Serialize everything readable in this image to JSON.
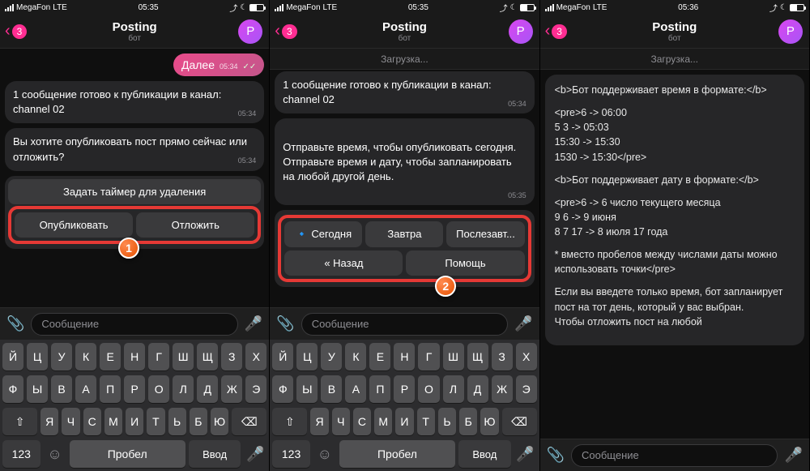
{
  "status": {
    "carrier": "MegaFon",
    "net": "LTE",
    "time1": "05:35",
    "time2": "05:35",
    "time3": "05:36",
    "moon": "☾"
  },
  "nav": {
    "back_badge": "3",
    "title": "Posting",
    "subtitle": "бот",
    "avatar_letter": "P"
  },
  "loading": "Загрузка...",
  "p1": {
    "out_msg": "Далее",
    "out_time": "05:34",
    "b1": "1 сообщение готово к публикации в канал: channel 02",
    "b1_time": "05:34",
    "b2": "Вы хотите опубликовать пост прямо сейчас или отложить?",
    "b2_time": "05:34",
    "kb_timer": "Задать таймер для удаления",
    "kb_publish": "Опубликовать",
    "kb_delay": "Отложить"
  },
  "p2": {
    "b1_l1": "1 сообщение готово к публикации в канал: channel 02",
    "b1_time": "05:34",
    "b2": "Отправьте время, чтобы опубликовать сегодня.\nОтправьте время и дату, чтобы запланировать на любой другой день.",
    "b2_time": "05:35",
    "kb_today": "🔹 Сегодня",
    "kb_tomorrow": "Завтра",
    "kb_after": "Послезавт...",
    "kb_back": "« Назад",
    "kb_help": "Помощь"
  },
  "p3": {
    "line1": "<b>Бот поддерживает время в формате:</b>",
    "line2": "<pre>6      -> 06:00",
    "line3": "5 3   -> 05:03",
    "line4": "15:30 -> 15:30",
    "line5": "1530  -> 15:30</pre>",
    "dfmt": "<b>Бот поддерживает дату в формате:</b>",
    "d1": "<pre>6     -> 6 число текущего месяца",
    "d2": "9 6   -> 9 июня",
    "d3": "8 7 17 -> 8 июля 17 года",
    "note": "* вместо пробелов между числами даты можно использовать точки</pre>",
    "tail": "Если вы введете только время, бот запланирует пост на тот день, который у вас выбран.\nЧтобы отложить пост на любой"
  },
  "input": {
    "placeholder": "Сообщение"
  },
  "keys": {
    "r1": [
      "Й",
      "Ц",
      "У",
      "К",
      "Е",
      "Н",
      "Г",
      "Ш",
      "Щ",
      "З",
      "Х"
    ],
    "r2": [
      "Ф",
      "Ы",
      "В",
      "А",
      "П",
      "Р",
      "О",
      "Л",
      "Д",
      "Ж",
      "Э"
    ],
    "r3": [
      "Я",
      "Ч",
      "С",
      "М",
      "И",
      "Т",
      "Ь",
      "Б",
      "Ю"
    ],
    "num": "123",
    "space": "Пробел",
    "enter": "Ввод"
  },
  "markers": {
    "m1": "1",
    "m2": "2"
  }
}
